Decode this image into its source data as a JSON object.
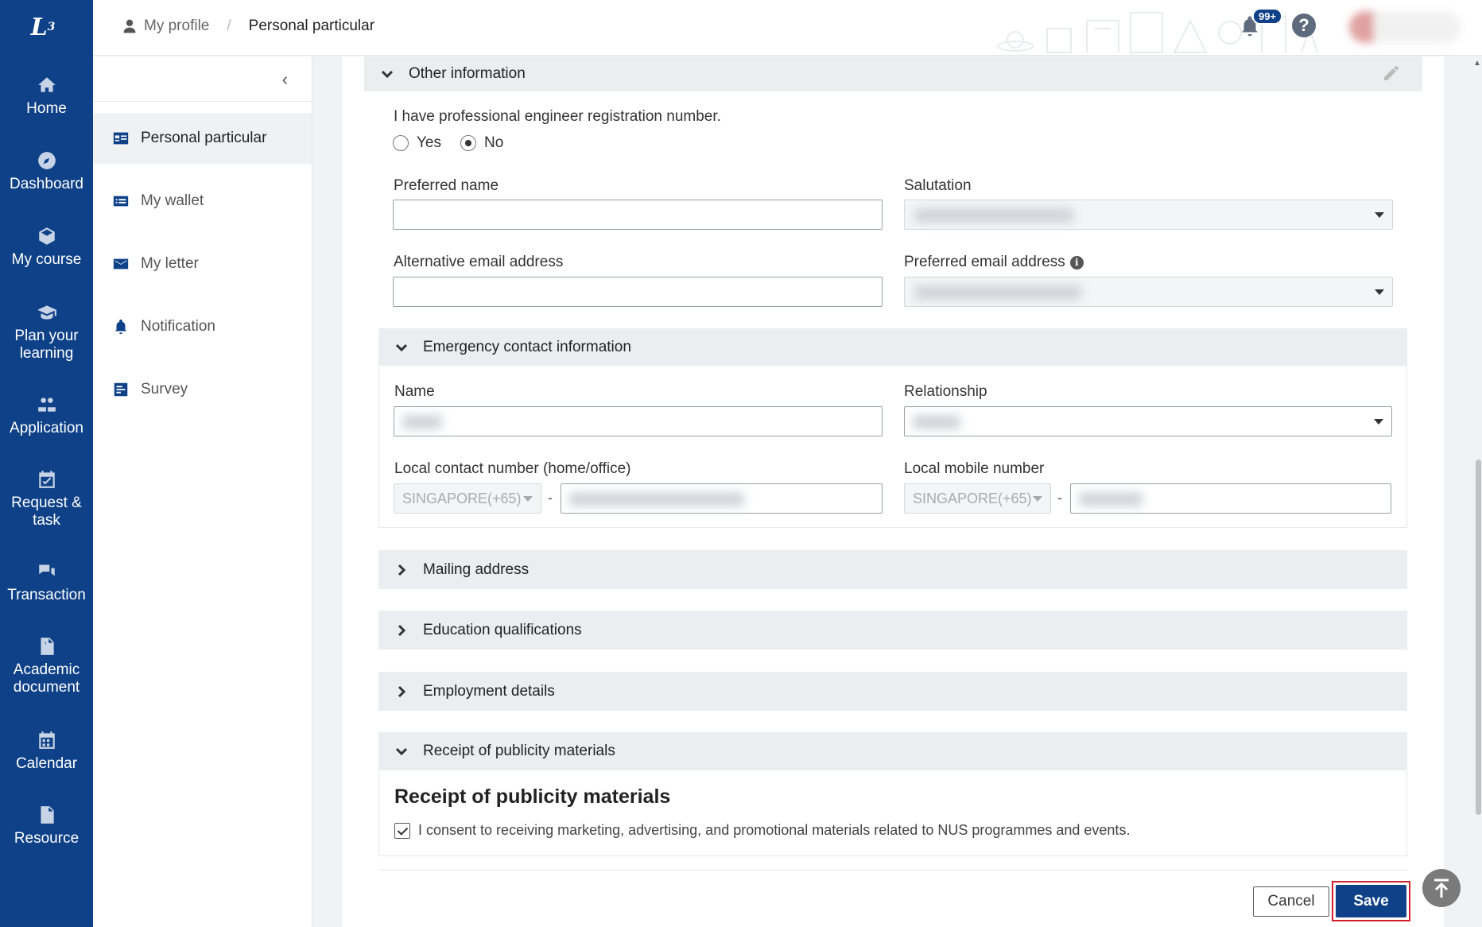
{
  "app": {
    "logo_text": "L",
    "logo_sub": "3"
  },
  "nav": {
    "items": [
      {
        "label": "Home",
        "icon": "home-icon"
      },
      {
        "label": "Dashboard",
        "icon": "compass-icon"
      },
      {
        "label": "My course",
        "icon": "cube-icon"
      },
      {
        "label": "Plan your learning",
        "icon": "graduation-cap-icon"
      },
      {
        "label": "Application",
        "icon": "people-icon"
      },
      {
        "label": "Request & task",
        "icon": "calendar-check-icon"
      },
      {
        "label": "Transaction",
        "icon": "chat-icon"
      },
      {
        "label": "Academic document",
        "icon": "pdf-file-icon"
      },
      {
        "label": "Calendar",
        "icon": "calendar-icon"
      },
      {
        "label": "Resource",
        "icon": "file-icon"
      }
    ]
  },
  "header": {
    "breadcrumb_1": "My profile",
    "breadcrumb_sep": "/",
    "breadcrumb_2": "Personal particular",
    "notification_badge": "99+",
    "help": "?"
  },
  "side": {
    "collapse": "‹",
    "items": [
      {
        "label": "Personal particular",
        "active": true
      },
      {
        "label": "My wallet"
      },
      {
        "label": "My letter"
      },
      {
        "label": "Notification"
      },
      {
        "label": "Survey"
      }
    ]
  },
  "other_info": {
    "title": "Other information",
    "question": "I have professional engineer registration number.",
    "yes": "Yes",
    "no": "No",
    "selected": "No",
    "preferred_name_label": "Preferred name",
    "preferred_name_value": "",
    "salutation_label": "Salutation",
    "alt_email_label": "Alternative email address",
    "alt_email_value": "",
    "pref_email_label": "Preferred email address",
    "info": "i"
  },
  "emergency": {
    "title": "Emergency contact information",
    "name_label": "Name",
    "relationship_label": "Relationship",
    "local_contact_label": "Local contact number (home/office)",
    "local_mobile_label": "Local mobile number",
    "country_code_1": "SINGAPORE(+65)",
    "country_code_2": "SINGAPORE(+65)",
    "dash": "-"
  },
  "sections": {
    "mailing": "Mailing address",
    "education": "Education qualifications",
    "employment": "Employment details",
    "publicity": "Receipt of publicity materials"
  },
  "publicity": {
    "heading": "Receipt of publicity materials",
    "consent": "I consent to receiving marketing, advertising, and promotional materials related to NUS programmes and events.",
    "checked": true
  },
  "actions": {
    "cancel": "Cancel",
    "save": "Save"
  },
  "colors": {
    "nav_bg": "#0e4187",
    "save_outline": "#d0202e",
    "section_bg": "#ebedf0"
  }
}
